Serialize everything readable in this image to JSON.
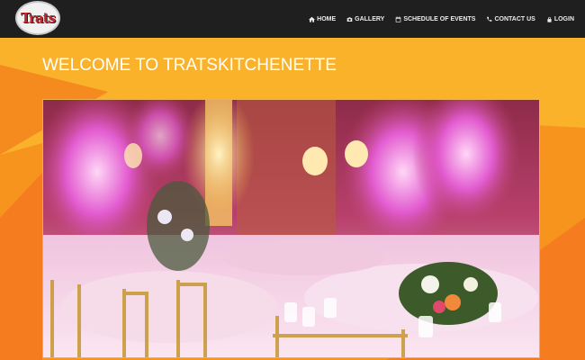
{
  "header": {
    "logo_alt": "Trats",
    "nav": [
      {
        "label": "HOME",
        "icon": "home-icon"
      },
      {
        "label": "GALLERY",
        "icon": "camera-icon"
      },
      {
        "label": "SCHEDULE OF EVENTS",
        "icon": "calendar-icon"
      },
      {
        "label": "CONTACT US",
        "icon": "phone-icon"
      },
      {
        "label": "LOGIN",
        "icon": "lock-icon"
      }
    ]
  },
  "main": {
    "title": "WELCOME TO TRATSKITCHENETTE",
    "hero_image": "banquet-hall-photo"
  },
  "colors": {
    "navbar": "#1f1f1f",
    "background": "#f7a21c",
    "accent_orange": "#f58220",
    "text_light": "#ffffff"
  }
}
